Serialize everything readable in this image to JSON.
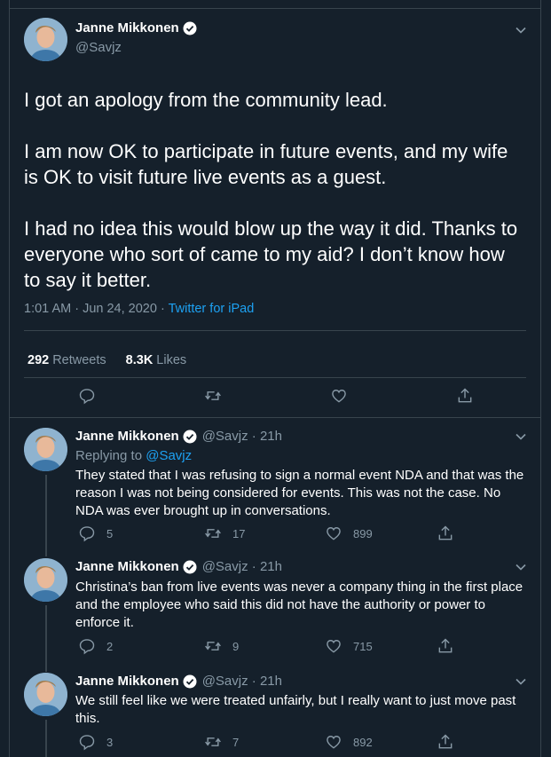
{
  "main_tweet": {
    "name": "Janne Mikkonen",
    "handle": "@Savjz",
    "paragraphs": [
      "I got an apology from the community lead.",
      "I am now OK to participate in future events, and my wife is OK to visit future live events as a guest.",
      "I had no idea this would blow up the way it did. Thanks to everyone who sort of came to my aid? I don’t know how to say it better."
    ],
    "timestamp": "1:01 AM · Jun 24, 2020 · ",
    "source": "Twitter for iPad",
    "retweets_count": "292",
    "retweets_label": "Retweets",
    "likes_count": "8.3K",
    "likes_label": "Likes"
  },
  "replies": [
    {
      "name": "Janne Mikkonen",
      "handle_time": "@Savjz · 21h",
      "replying_prefix": "Replying to ",
      "replying_to": "@Savjz",
      "text": "They stated that I was refusing to sign a normal event NDA and that was the reason I was not being considered for events. This was not the case. No NDA was ever brought up in conversations.",
      "reply_count": "5",
      "retweet_count": "17",
      "like_count": "899"
    },
    {
      "name": "Janne Mikkonen",
      "handle_time": "@Savjz · 21h",
      "text": "Christina’s ban from live events was never a company thing in the first place and the employee who said this did not have the authority or power to enforce it.",
      "reply_count": "2",
      "retweet_count": "9",
      "like_count": "715"
    },
    {
      "name": "Janne Mikkonen",
      "handle_time": "@Savjz · 21h",
      "text": "We still feel like we were treated unfairly, but I really want to just move past this.",
      "reply_count": "3",
      "retweet_count": "7",
      "like_count": "892"
    }
  ],
  "colors": {
    "background": "#15202b",
    "accent": "#1da1f2",
    "muted": "#8899a6",
    "border": "#38444d"
  },
  "icons": [
    "verified-icon",
    "chevron-down-icon",
    "reply-icon",
    "retweet-icon",
    "like-icon",
    "share-icon"
  ]
}
